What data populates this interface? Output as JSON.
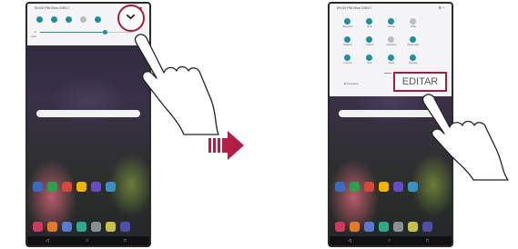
{
  "left_tablet": {
    "status_time": "09:00 PM Mon 2/8/17",
    "status_icons": "▴ ■",
    "quick_settings": {
      "tiles": [
        {
          "icon": "tile-icon",
          "active": true
        },
        {
          "icon": "tile-icon",
          "active": true
        },
        {
          "icon": "tile-icon",
          "active": true
        },
        {
          "icon": "tile-icon",
          "active": false
        },
        {
          "icon": "tile-icon",
          "active": true
        }
      ],
      "brightness_label": "Auto",
      "expand_icon": "chevron-down-icon"
    },
    "nav_keys": [
      "◁",
      "○",
      "□"
    ]
  },
  "right_tablet": {
    "status_time": "09:00 PM Mon 2/8/17",
    "status_icons": "⚙ ^",
    "tiles": [
      {
        "label": "Bluetooth",
        "active": true
      },
      {
        "label": "Wi-Fi",
        "active": true
      },
      {
        "label": "Sonido",
        "active": true
      },
      {
        "label": "Brillo",
        "active": false
      },
      {
        "label": "Rotación",
        "active": true
      },
      {
        "label": "Captura",
        "active": true
      },
      {
        "label": "Ubicación",
        "active": false
      },
      {
        "label": "Modo avión",
        "active": true
      },
      {
        "label": "Linterna",
        "active": true
      },
      {
        "label": "NFC",
        "active": true
      },
      {
        "label": "Datos",
        "active": true
      },
      {
        "label": "Mensaje",
        "active": true
      }
    ],
    "footer_left": "■ Controles",
    "edit_button_label": "EDITAR",
    "nav_keys": [
      "◁",
      "○",
      "□"
    ]
  },
  "colors": {
    "accent": "#a51c3a",
    "tile_active": "#1f8f9e",
    "panel_bg": "#f4f4f6"
  },
  "transition_icon": "right-arrow-icon"
}
